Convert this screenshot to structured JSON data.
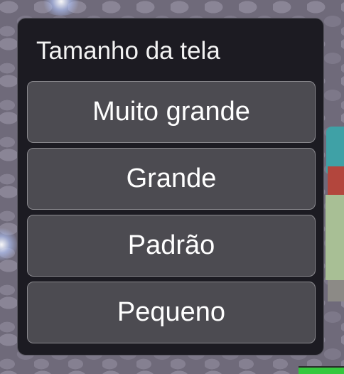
{
  "dialog": {
    "title": "Tamanho da tela",
    "options": [
      {
        "label": "Muito grande"
      },
      {
        "label": "Grande"
      },
      {
        "label": "Padrão"
      },
      {
        "label": "Pequeno"
      }
    ]
  },
  "colors": {
    "dialog_background": "#1c1b22",
    "button_background": "#4c4b51",
    "button_border": "#8a898e",
    "text": "#ffffff",
    "status_bar": "#35c83e"
  }
}
